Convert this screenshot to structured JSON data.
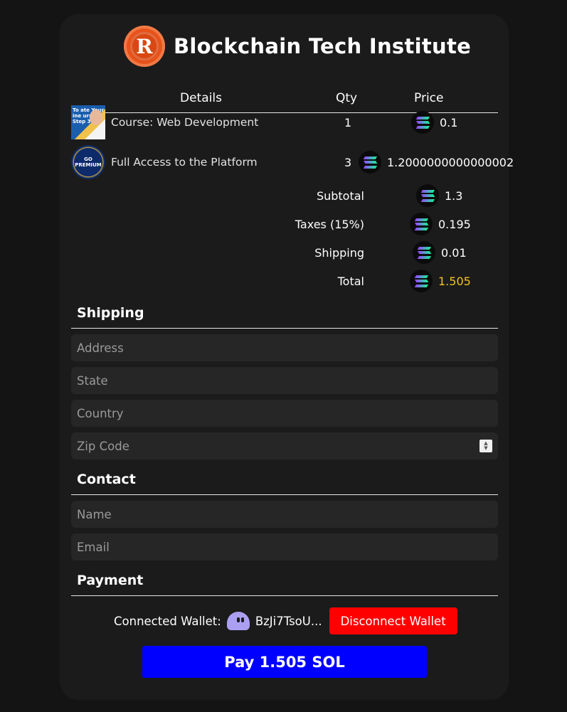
{
  "header": {
    "title": "Blockchain Tech Institute",
    "logo_letter": "R"
  },
  "table": {
    "columns": {
      "details": "Details",
      "qty": "Qty",
      "price": "Price"
    },
    "items": [
      {
        "thumb_text": "To ate Your ine urse Step 3",
        "name": "Course: Web Development",
        "qty": "1",
        "price": "0.1"
      },
      {
        "thumb_text": "GO PREMIUM",
        "name": "Full Access to the Platform",
        "qty": "3",
        "price": "1.2000000000000002"
      }
    ]
  },
  "summary": {
    "subtotal": {
      "label": "Subtotal",
      "value": "1.3"
    },
    "taxes": {
      "label": "Taxes (15%)",
      "value": "0.195"
    },
    "shipping": {
      "label": "Shipping",
      "value": "0.01"
    },
    "total": {
      "label": "Total",
      "value": "1.505"
    }
  },
  "shipping_section": {
    "title": "Shipping",
    "address_placeholder": "Address",
    "state_placeholder": "State",
    "country_placeholder": "Country",
    "zip_placeholder": "Zip Code"
  },
  "contact_section": {
    "title": "Contact",
    "name_placeholder": "Name",
    "email_placeholder": "Email"
  },
  "payment_section": {
    "title": "Payment",
    "wallet_label": "Connected Wallet:",
    "wallet_address": "BzJi7TsoU...",
    "disconnect_label": "Disconnect Wallet",
    "pay_label": "Pay 1.505 SOL"
  },
  "colors": {
    "total": "#f0c417",
    "disconnect": "#ff0000",
    "pay": "#0000ff"
  },
  "icons": {
    "currency": "solana-icon",
    "wallet": "phantom-ghost-icon"
  }
}
